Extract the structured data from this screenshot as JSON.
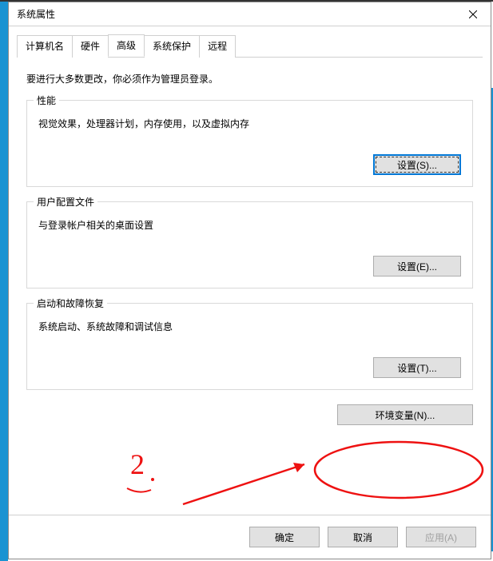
{
  "window": {
    "title": "系统属性"
  },
  "tabs": {
    "t0": "计算机名",
    "t1": "硬件",
    "t2": "高级",
    "t3": "系统保护",
    "t4": "远程"
  },
  "intro": "要进行大多数更改，你必须作为管理员登录。",
  "groups": {
    "perf": {
      "label": "性能",
      "desc": "视觉效果，处理器计划，内存使用，以及虚拟内存",
      "button": "设置(S)..."
    },
    "profile": {
      "label": "用户配置文件",
      "desc": "与登录帐户相关的桌面设置",
      "button": "设置(E)..."
    },
    "startup": {
      "label": "启动和故障恢复",
      "desc": "系统启动、系统故障和调试信息",
      "button": "设置(T)..."
    }
  },
  "env_button": "环境变量(N)...",
  "footer": {
    "ok": "确定",
    "cancel": "取消",
    "apply": "应用(A)"
  },
  "annotation": {
    "step": "2"
  }
}
